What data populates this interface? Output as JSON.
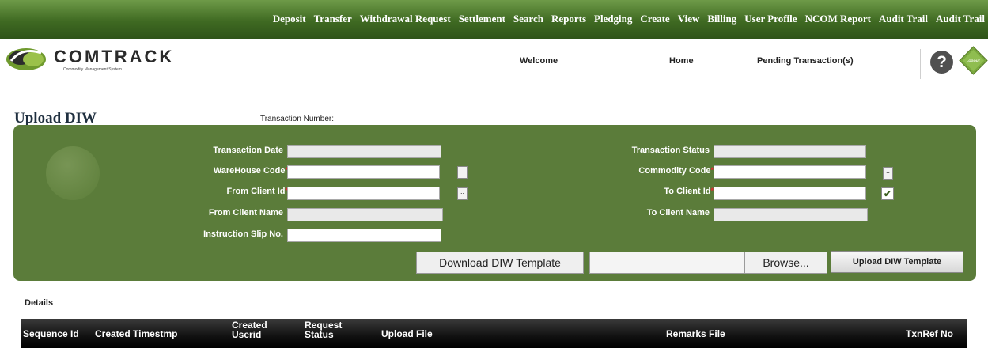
{
  "nav": {
    "items": [
      "Deposit",
      "Transfer",
      "Withdrawal Request",
      "Settlement",
      "Search",
      "Reports",
      "Pledging",
      "Create",
      "View",
      "Billing",
      "User Profile",
      "NCOM Report",
      "Audit Trail",
      "Audit Trail"
    ]
  },
  "header": {
    "logo_text": "COMTRACK",
    "logo_tagline": "Commodity Management System",
    "welcome": "Welcome",
    "home": "Home",
    "pending": "Pending Transaction(s)",
    "help_glyph": "?",
    "logout_text": "LOGOUT"
  },
  "page": {
    "title": "Upload DIW",
    "txn_number_label": "Transaction Number:"
  },
  "form": {
    "left": {
      "transaction_date": {
        "label": "Transaction Date",
        "value": ""
      },
      "warehouse_code": {
        "label": "WareHouse Code",
        "value": ""
      },
      "from_client_id": {
        "label": "From Client Id",
        "value": ""
      },
      "from_client_name": {
        "label": "From Client Name",
        "value": ""
      },
      "instruction_slip_no": {
        "label": "Instruction Slip No.",
        "value": ""
      }
    },
    "right": {
      "transaction_status": {
        "label": "Transaction Status",
        "value": ""
      },
      "commodity_code": {
        "label": "Commodity Code",
        "value": ""
      },
      "to_client_id": {
        "label": "To Client Id",
        "value": ""
      },
      "to_client_name": {
        "label": "To Client Name",
        "value": ""
      }
    },
    "required_marker": "*",
    "lookup_label": "..",
    "check_glyph": "✔",
    "download_template": "Download DIW Template",
    "browse": "Browse...",
    "upload_template": "Upload DIW Template"
  },
  "details_label": "Details",
  "table": {
    "columns": [
      "Sequence Id",
      "Created Timestmp",
      "Created Userid",
      "Request Status",
      "Upload File",
      "Remarks File",
      "TxnRef No"
    ],
    "rows": []
  },
  "colors": {
    "nav_green": "#3f6a22",
    "panel_green": "#5b7c3a",
    "table_header": "#111111"
  }
}
